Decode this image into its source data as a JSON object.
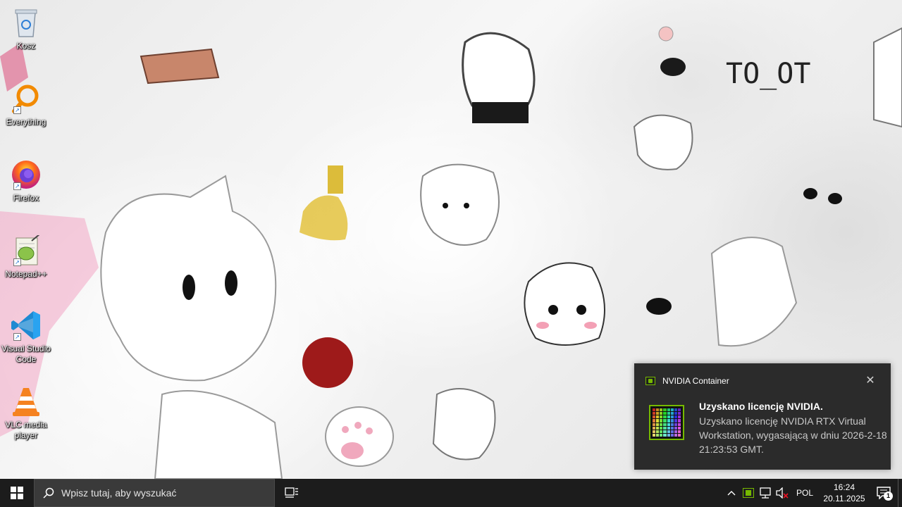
{
  "desktop": {
    "icons": [
      {
        "label": "Kosz",
        "icon": "recycle-bin-icon"
      },
      {
        "label": "Everything",
        "icon": "everything-search-icon"
      },
      {
        "label": "Firefox",
        "icon": "firefox-icon"
      },
      {
        "label": "Notepad++",
        "icon": "notepad-plus-plus-icon"
      },
      {
        "label": "Visual Studio Code",
        "icon": "vscode-icon"
      },
      {
        "label": "VLC media player",
        "icon": "vlc-icon"
      }
    ],
    "wallpaper_text": "TO_OT"
  },
  "notification": {
    "app_name": "NVIDIA Container",
    "title": "Uzyskano licencję NVIDIA.",
    "body": "Uzyskano licencję NVIDIA RTX Virtual Workstation, wygasającą w dniu 2026-2-18 21:23:53 GMT.",
    "close": "✕",
    "accent_color": "#76b900"
  },
  "taskbar": {
    "search_placeholder": "Wpisz tutaj, aby wyszukać",
    "tray": {
      "chevron": "^",
      "language": "POL",
      "time": "16:24",
      "date": "20.11.2025",
      "notifications_count": "1"
    }
  }
}
